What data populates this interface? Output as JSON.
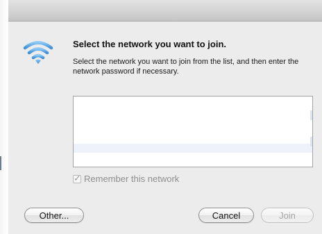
{
  "dialog": {
    "headline": "Select the network you want to join.",
    "body": "Select the network you want to join from the list, and then enter the network password if necessary."
  },
  "network_list": {
    "items": []
  },
  "remember": {
    "label": "Remember this network",
    "checked": true,
    "enabled": false
  },
  "buttons": {
    "other": "Other...",
    "cancel": "Cancel",
    "join": "Join"
  },
  "icons": {
    "wifi": "wifi-icon",
    "check": "check-icon"
  },
  "colors": {
    "wifi_blue": "#5aa7e6",
    "dialog_bg": "#ececec",
    "disabled_text": "#a6a6a6"
  }
}
